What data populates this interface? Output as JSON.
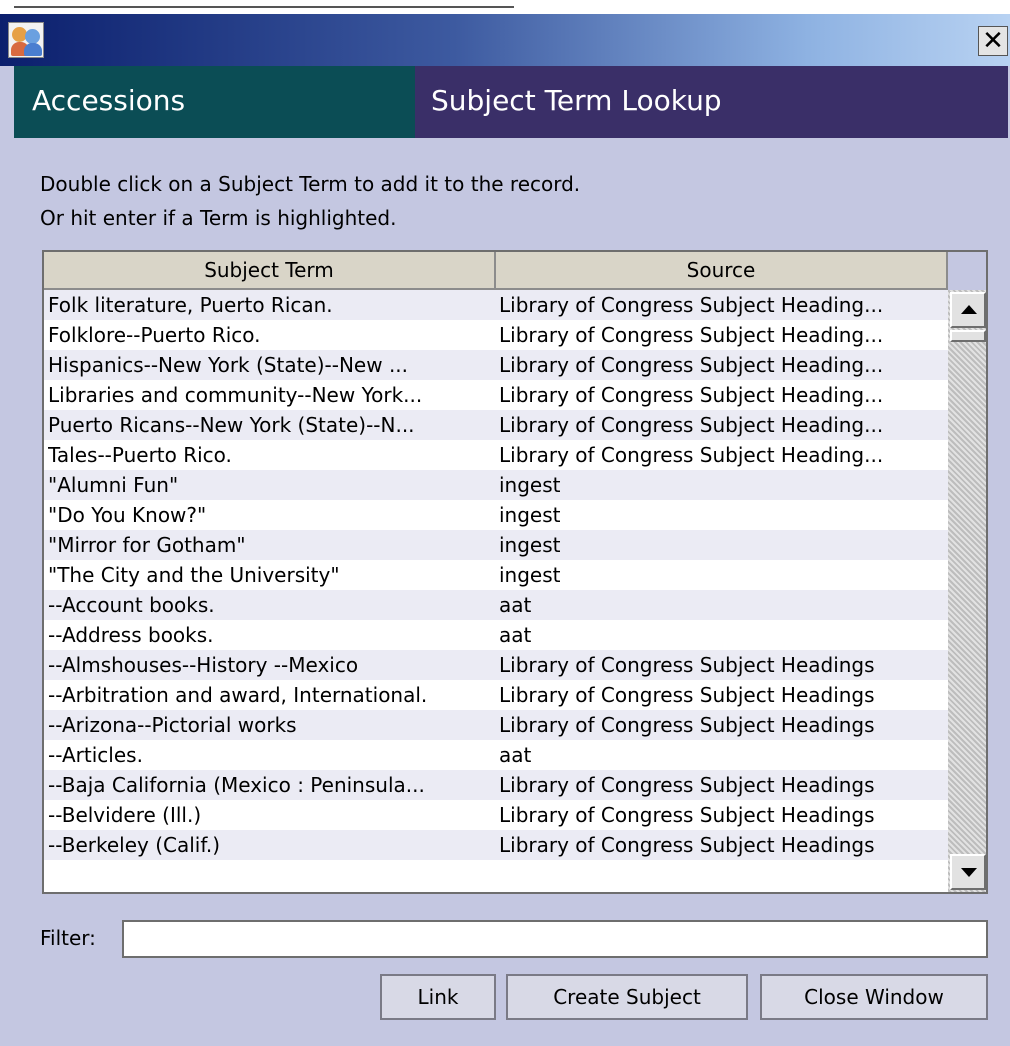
{
  "window": {
    "app_icon": "users-icon",
    "close_glyph": "✕"
  },
  "header": {
    "left_title": "Accessions",
    "right_title": "Subject Term Lookup"
  },
  "instructions": {
    "line1": "Double click on a Subject Term to add it to the record.",
    "line2": "Or hit enter if a Term is highlighted."
  },
  "table": {
    "columns": [
      "Subject Term",
      "Source"
    ],
    "rows": [
      {
        "term": " Folk literature, Puerto Rican.",
        "source": "Library of Congress Subject Heading..."
      },
      {
        "term": " Folklore--Puerto Rico.",
        "source": "Library of Congress Subject Heading..."
      },
      {
        "term": " Hispanics--New York (State)--New ...",
        "source": "Library of Congress Subject Heading..."
      },
      {
        "term": " Libraries and community--New York...",
        "source": "Library of Congress Subject Heading..."
      },
      {
        "term": " Puerto Ricans--New York (State)--N...",
        "source": "Library of Congress Subject Heading..."
      },
      {
        "term": " Tales--Puerto Rico.",
        "source": "Library of Congress Subject Heading..."
      },
      {
        "term": "\"Alumni Fun\"",
        "source": "ingest"
      },
      {
        "term": "\"Do You Know?\"",
        "source": "ingest"
      },
      {
        "term": "\"Mirror for Gotham\"",
        "source": "ingest"
      },
      {
        "term": "\"The City and the University\"",
        "source": "ingest"
      },
      {
        "term": "--Account books.",
        "source": "aat"
      },
      {
        "term": "--Address books.",
        "source": "aat"
      },
      {
        "term": "--Almshouses--History --Mexico",
        "source": "Library of Congress Subject Headings"
      },
      {
        "term": "--Arbitration and award, International.",
        "source": "Library of Congress Subject Headings"
      },
      {
        "term": "--Arizona--Pictorial works",
        "source": "Library of Congress Subject Headings"
      },
      {
        "term": "--Articles.",
        "source": "aat"
      },
      {
        "term": "--Baja California (Mexico : Peninsula...",
        "source": "Library of Congress Subject Headings"
      },
      {
        "term": "--Belvidere (Ill.)",
        "source": "Library of Congress Subject Headings"
      },
      {
        "term": "--Berkeley (Calif.)",
        "source": "Library of Congress Subject Headings"
      }
    ]
  },
  "filter": {
    "label": "Filter:",
    "value": ""
  },
  "buttons": {
    "link": "Link",
    "create_subject": "Create Subject",
    "close_window": "Close Window"
  },
  "colors": {
    "window_bg": "#c4c7e1",
    "header_left": "#0b4d55",
    "header_right": "#3a2f68",
    "titlebar_start": "#0b1f6d",
    "titlebar_end": "#b8d2f2"
  }
}
